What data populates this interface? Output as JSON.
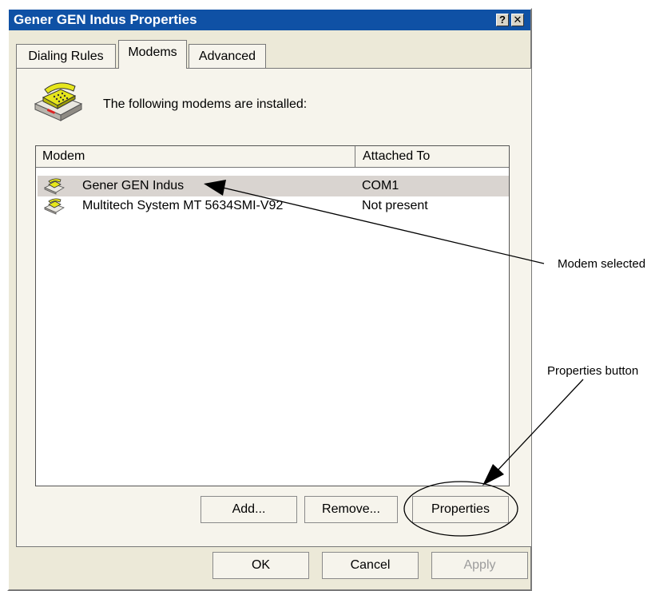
{
  "window": {
    "title": "Gener GEN Indus Properties",
    "help_button": "?",
    "close_button": "✕"
  },
  "tabs": [
    {
      "label": "Dialing Rules",
      "active": false
    },
    {
      "label": "Modems",
      "active": true
    },
    {
      "label": "Advanced",
      "active": false
    }
  ],
  "modems_tab": {
    "heading_icon": "telephone-modem-icon",
    "intro_text": "The following modems are installed:",
    "list": {
      "columns": [
        "Modem",
        "Attached To"
      ],
      "rows": [
        {
          "icon": "modem-icon",
          "name": "Gener GEN Indus",
          "attached_to": "COM1",
          "selected": true
        },
        {
          "icon": "modem-icon",
          "name": "Multitech System MT 5634SMI-V92",
          "attached_to": "Not present",
          "selected": false
        }
      ]
    },
    "buttons": {
      "add": "Add...",
      "remove": "Remove...",
      "properties": "Properties"
    }
  },
  "dialog_buttons": {
    "ok": "OK",
    "cancel": "Cancel",
    "apply": "Apply",
    "apply_enabled": false
  },
  "annotations": {
    "modem_selected": "Modem selected",
    "properties_button": "Properties button"
  },
  "colors": {
    "title_bar": "#0f51a5",
    "dialog_face": "#ece9d8",
    "selection": "#d9d4d0",
    "icon_yellow": "#e6e61c"
  }
}
